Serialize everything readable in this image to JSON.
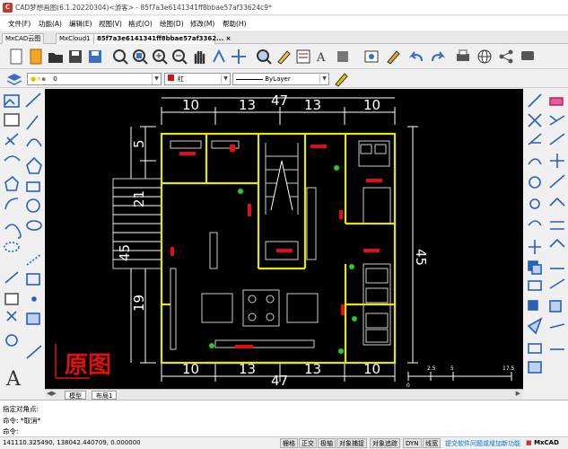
{
  "window": {
    "title": "CAD梦想画图(6.1.20220304)<游客> - 85f7a3e6141341ff8bbae57af33624c9*"
  },
  "menu": [
    "文件(F)",
    "功能(A)",
    "编辑(E)",
    "视图(V)",
    "格式(O)",
    "绘图(D)",
    "修改(M)",
    "帮助(H)"
  ],
  "tabs": [
    "MxCAD云图",
    "MxCloud1",
    "85f7a3e6141341ff8bbae57af3362..."
  ],
  "tab_close": "×",
  "layer_combo": "0",
  "color_combo": "红",
  "linetype_combo": "ByLayer",
  "drawing": {
    "top_dims": [
      "10",
      "13",
      "13",
      "10"
    ],
    "top_total": "47",
    "bottom_dims": [
      "10",
      "13",
      "13",
      "10"
    ],
    "bottom_total": "47",
    "left_dims": [
      "5",
      "21",
      "19"
    ],
    "left_total": "45",
    "right_total": "45",
    "label": "原图",
    "scale_labels": [
      "0",
      "2.5",
      "5",
      "17.5"
    ]
  },
  "layout_tabs": [
    "模型",
    "布局1"
  ],
  "command": {
    "line1": "指定对角点:",
    "line2_prefix": "命令:",
    "line2_value": "*取消*",
    "line3_prefix": "命令:"
  },
  "status": {
    "coords": "141110.325490,  138042.440709,  0.000000",
    "buttons": [
      "栅格",
      "正交",
      "极轴",
      "对象捕捉",
      "对象追踪",
      "DYN",
      "线宽"
    ],
    "link": "提交软件问题或增加新功能",
    "brand": "MxCAD"
  },
  "colors": {
    "accent": "#0078d7",
    "label_red": "#e01010",
    "canvas": "#000000",
    "wall": "#e6e600"
  }
}
